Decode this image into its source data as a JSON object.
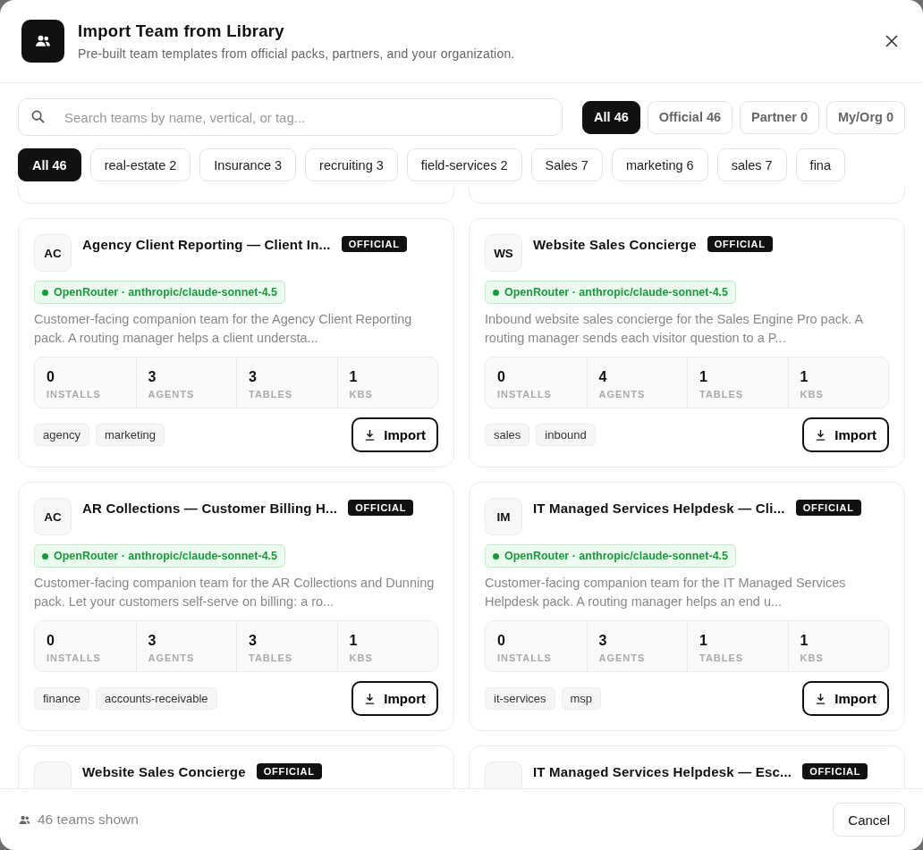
{
  "dialog": {
    "title": "Import Team from Library",
    "subtitle": "Pre-built team templates from official packs, partners, and your organization."
  },
  "search": {
    "placeholder": "Search teams by name, vertical, or tag..."
  },
  "source_filters": [
    {
      "label": "All 46",
      "selected": true
    },
    {
      "label": "Official 46",
      "selected": false
    },
    {
      "label": "Partner 0",
      "selected": false
    },
    {
      "label": "My/Org 0",
      "selected": false
    }
  ],
  "tag_filters": [
    {
      "label": "All 46",
      "selected": true
    },
    {
      "label": "real-estate 2",
      "selected": false
    },
    {
      "label": "Insurance 3",
      "selected": false
    },
    {
      "label": "recruiting 3",
      "selected": false
    },
    {
      "label": "field-services 2",
      "selected": false
    },
    {
      "label": "Sales 7",
      "selected": false
    },
    {
      "label": "marketing 6",
      "selected": false
    },
    {
      "label": "sales 7",
      "selected": false
    },
    {
      "label": "fina",
      "selected": false
    }
  ],
  "teams": [
    {
      "initials": "AC",
      "title": "Agency Client Reporting — Client In...",
      "badge": "OFFICIAL",
      "model": "OpenRouter · anthropic/claude-sonnet-4.5",
      "description": "Customer-facing companion team for the Agency Client Reporting pack. A routing manager helps a client understa...",
      "stats": [
        {
          "value": "0",
          "label": "INSTALLS"
        },
        {
          "value": "3",
          "label": "AGENTS"
        },
        {
          "value": "3",
          "label": "TABLES"
        },
        {
          "value": "1",
          "label": "KBS"
        }
      ],
      "tags": [
        "agency",
        "marketing"
      ],
      "action": "Import"
    },
    {
      "initials": "WS",
      "title": "Website Sales Concierge",
      "badge": "OFFICIAL",
      "model": "OpenRouter · anthropic/claude-sonnet-4.5",
      "description": "Inbound website sales concierge for the Sales Engine Pro pack. A routing manager sends each visitor question to a P...",
      "stats": [
        {
          "value": "0",
          "label": "INSTALLS"
        },
        {
          "value": "4",
          "label": "AGENTS"
        },
        {
          "value": "1",
          "label": "TABLES"
        },
        {
          "value": "1",
          "label": "KBS"
        }
      ],
      "tags": [
        "sales",
        "inbound"
      ],
      "action": "Import"
    },
    {
      "initials": "AC",
      "title": "AR Collections — Customer Billing H...",
      "badge": "OFFICIAL",
      "model": "OpenRouter · anthropic/claude-sonnet-4.5",
      "description": "Customer-facing companion team for the AR Collections and Dunning pack. Let your customers self-serve on billing: a ro...",
      "stats": [
        {
          "value": "0",
          "label": "INSTALLS"
        },
        {
          "value": "3",
          "label": "AGENTS"
        },
        {
          "value": "3",
          "label": "TABLES"
        },
        {
          "value": "1",
          "label": "KBS"
        }
      ],
      "tags": [
        "finance",
        "accounts-receivable"
      ],
      "action": "Import"
    },
    {
      "initials": "IM",
      "title": "IT Managed Services Helpdesk — Cli...",
      "badge": "OFFICIAL",
      "model": "OpenRouter · anthropic/claude-sonnet-4.5",
      "description": "Customer-facing companion team for the IT Managed Services Helpdesk pack. A routing manager helps an end u...",
      "stats": [
        {
          "value": "0",
          "label": "INSTALLS"
        },
        {
          "value": "3",
          "label": "AGENTS"
        },
        {
          "value": "1",
          "label": "TABLES"
        },
        {
          "value": "1",
          "label": "KBS"
        }
      ],
      "tags": [
        "it-services",
        "msp"
      ],
      "action": "Import"
    },
    {
      "title": "Website Sales Concierge",
      "badge": "OFFICIAL"
    },
    {
      "title": "IT Managed Services Helpdesk — Esc...",
      "badge": "OFFICIAL"
    }
  ],
  "footer": {
    "count": "46 teams shown",
    "cancel": "Cancel"
  }
}
